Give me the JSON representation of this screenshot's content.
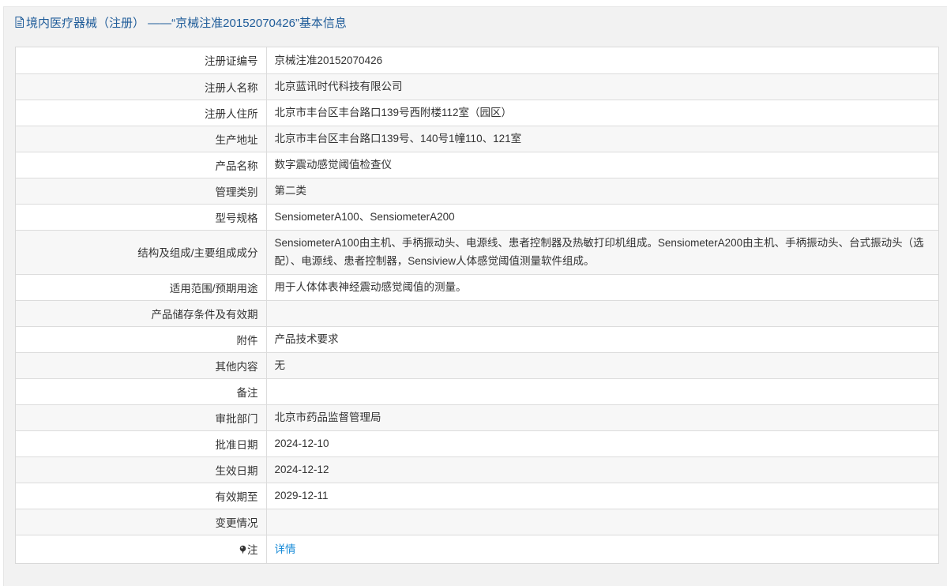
{
  "header": {
    "title": "境内医疗器械（注册） ——“京械注准20152070426”基本信息",
    "icon": "document-icon"
  },
  "rows": [
    {
      "label": "注册证编号",
      "value": "京械注准20152070426"
    },
    {
      "label": "注册人名称",
      "value": "北京蓝讯时代科技有限公司"
    },
    {
      "label": "注册人住所",
      "value": "北京市丰台区丰台路口139号西附楼112室（园区）"
    },
    {
      "label": "生产地址",
      "value": "北京市丰台区丰台路口139号、140号1幢110、121室"
    },
    {
      "label": "产品名称",
      "value": "数字震动感觉阈值检查仪"
    },
    {
      "label": "管理类别",
      "value": "第二类"
    },
    {
      "label": "型号规格",
      "value": "SensiometerA100、SensiometerA200"
    },
    {
      "label": "结构及组成/主要组成成分",
      "value": "SensiometerA100由主机、手柄振动头、电源线、患者控制器及热敏打印机组成。SensiometerA200由主机、手柄振动头、台式振动头（选配）、电源线、患者控制器，Sensiview人体感觉阈值测量软件组成。"
    },
    {
      "label": "适用范围/预期用途",
      "value": "用于人体体表神经震动感觉阈值的测量。"
    },
    {
      "label": "产品储存条件及有效期",
      "value": ""
    },
    {
      "label": "附件",
      "value": "产品技术要求"
    },
    {
      "label": "其他内容",
      "value": "无"
    },
    {
      "label": "备注",
      "value": ""
    },
    {
      "label": "审批部门",
      "value": "北京市药品监督管理局"
    },
    {
      "label": "批准日期",
      "value": "2024-12-10"
    },
    {
      "label": "生效日期",
      "value": "2024-12-12"
    },
    {
      "label": "有效期至",
      "value": "2029-12-11"
    },
    {
      "label": "变更情况",
      "value": ""
    }
  ],
  "note": {
    "label": "注",
    "icon": "pin-icon",
    "link_text": "详情",
    "link_color": "#1a8cd8"
  }
}
